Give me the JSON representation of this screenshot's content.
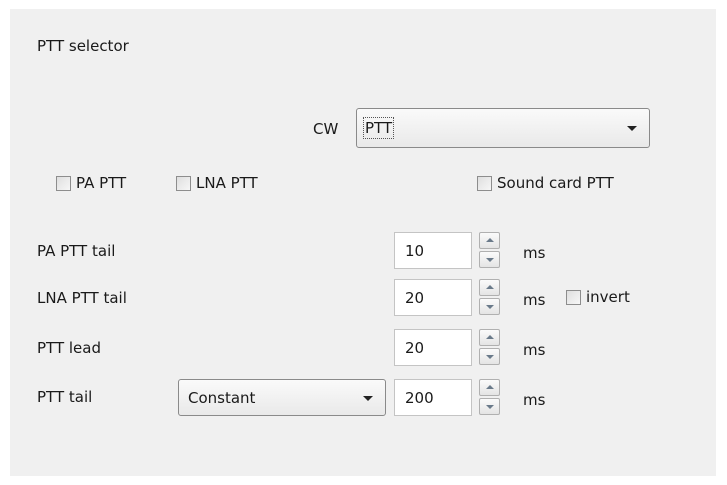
{
  "section_title": "PTT selector",
  "cw": {
    "label": "CW",
    "selected": "PTT"
  },
  "checkboxes": {
    "pa_ptt": {
      "label": "PA PTT",
      "checked": false
    },
    "lna_ptt": {
      "label": "LNA PTT",
      "checked": false
    },
    "sound_card_ptt": {
      "label": "Sound card PTT",
      "checked": false
    },
    "invert": {
      "label": "invert",
      "checked": false
    }
  },
  "rows": {
    "pa_ptt_tail": {
      "label": "PA PTT tail",
      "value": "10",
      "unit": "ms"
    },
    "lna_ptt_tail": {
      "label": "LNA PTT tail",
      "value": "20",
      "unit": "ms"
    },
    "ptt_lead": {
      "label": "PTT lead",
      "value": "20",
      "unit": "ms"
    },
    "ptt_tail": {
      "label": "PTT tail",
      "value": "200",
      "unit": "ms",
      "mode": "Constant"
    }
  },
  "icons": {
    "dropdown": "chevron-down-icon",
    "spin_up": "arrow-up-icon",
    "spin_down": "arrow-down-icon"
  },
  "colors": {
    "panel_background": "#f0f0f0",
    "page_background": "#ffffff",
    "field_background": "#ffffff"
  }
}
